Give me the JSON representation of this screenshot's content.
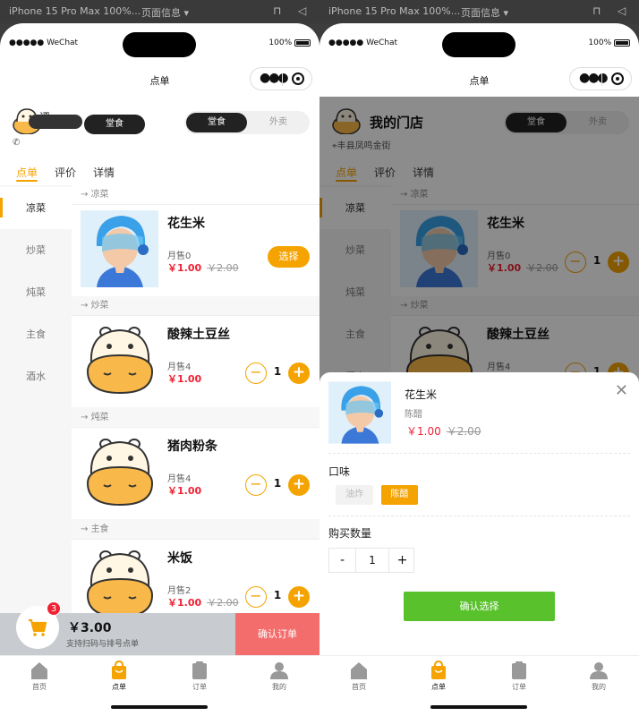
{
  "devtools": {
    "device": "iPhone 15 Pro Max 100%...",
    "page_info": "页面信息 ▾"
  },
  "status": {
    "signal": "●●●●● WeChat",
    "battery": "100%"
  },
  "navbar": {
    "title": "点单"
  },
  "shop": {
    "name": "我的门店",
    "address": "丰县凤鸣金街",
    "toggle_on": "堂食",
    "toggle_off": "外卖",
    "left_name_fragment": "评",
    "left_toggle_on": "堂食"
  },
  "tabs": {
    "order": "点单",
    "review": "评价",
    "detail": "详情"
  },
  "categories": [
    "凉菜",
    "炒菜",
    "炖菜",
    "主食",
    "酒水"
  ],
  "sections": [
    "凉菜",
    "炒菜",
    "炖菜",
    "主食"
  ],
  "products": [
    {
      "name": "花生米",
      "sold": "月售0",
      "price": "￥1.00",
      "old_price": "￥2.00",
      "select_label": "选择",
      "qty": "1"
    },
    {
      "name": "酸辣土豆丝",
      "sold": "月售4",
      "price": "￥1.00",
      "qty": "1"
    },
    {
      "name": "猪肉粉条",
      "sold": "月售4",
      "price": "￥1.00",
      "qty": "1"
    },
    {
      "name": "米饭",
      "sold": "月售2",
      "price": "￥1.00",
      "old_price": "￥2.00",
      "qty": "1"
    }
  ],
  "cart": {
    "count": "3",
    "total": "￥3.00",
    "hint": "支持扫码与排号点单",
    "confirm": "确认订单"
  },
  "tabbar": [
    "首页",
    "点单",
    "订单",
    "我的"
  ],
  "sheet": {
    "name": "花生米",
    "selected_option": "陈醋",
    "price": "￥1.00",
    "old_price": "￥2.00",
    "flavor_label": "口味",
    "options": [
      "油炸",
      "陈醋"
    ],
    "qty_label": "购买数量",
    "minus": "-",
    "qty": "1",
    "plus": "+",
    "confirm": "确认选择"
  },
  "colors": {
    "accent": "#f5a300",
    "price": "#ee2233",
    "confirm_order": "#f46d6d",
    "confirm_select": "#58c12b"
  }
}
